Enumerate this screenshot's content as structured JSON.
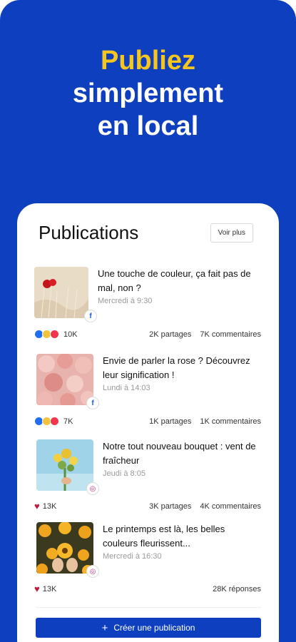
{
  "hero": {
    "accent": "Publiez",
    "line2": "simplement",
    "line3": "en local"
  },
  "card": {
    "title": "Publications",
    "see_more": "Voir plus"
  },
  "posts": [
    {
      "headline": "Une touche de couleur, ça fait pas de mal, non ?",
      "date": "Mercredi à 9:30",
      "network": "facebook",
      "reactions_count": "10K",
      "shares": "2K partages",
      "comments": "7K commentaires"
    },
    {
      "headline": "Envie de parler la rose ? Découvrez leur signification !",
      "date": "Lundi à 14:03",
      "network": "facebook",
      "reactions_count": "7K",
      "shares": "1K partages",
      "comments": "1K commentaires"
    },
    {
      "headline": "Notre tout nouveau bouquet : vent de fraîcheur",
      "date": "Jeudi à 8:05",
      "network": "instagram",
      "reactions_count": "13K",
      "shares": "3K partages",
      "comments": "4K commentaires"
    },
    {
      "headline": "Le printemps est là, les belles couleurs fleurissent...",
      "date": "Mercredi à 16:30",
      "network": "instagram",
      "reactions_count": "13K",
      "shares": "",
      "comments": "28K réponses"
    }
  ],
  "create_button": {
    "label": "Créer une publication"
  },
  "colors": {
    "brand_blue": "#0e3fbf",
    "accent_yellow": "#f7c61e"
  }
}
